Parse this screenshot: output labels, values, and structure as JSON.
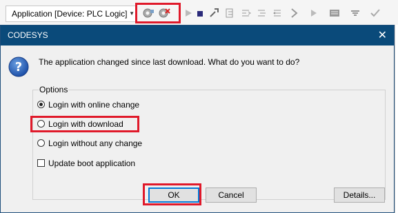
{
  "toolbar": {
    "app_combo_text": "Application [Device: PLC Logic]",
    "icons": [
      "login-icon",
      "logout-icon",
      "run-icon",
      "stop-icon",
      "reset-icon",
      "breakpoint-icon",
      "step-over-icon",
      "step-into-icon",
      "step-out-icon",
      "current-statement-icon",
      "write-values-icon",
      "force-values-icon",
      "unforce-icon"
    ]
  },
  "dialog": {
    "title": "CODESYS",
    "close_glyph": "✕",
    "message": "The application changed since last download. What do you want to do?",
    "options_label": "Options",
    "options": [
      {
        "label": "Login with online change",
        "selected": true
      },
      {
        "label": "Login with download",
        "selected": false
      },
      {
        "label": "Login without any change",
        "selected": false
      }
    ],
    "checkbox": {
      "label": "Update boot application",
      "checked": false
    },
    "buttons": {
      "ok": "OK",
      "cancel": "Cancel",
      "details": "Details..."
    }
  },
  "colors": {
    "titlebar": "#0a4a7a",
    "highlight": "#e0192a"
  }
}
